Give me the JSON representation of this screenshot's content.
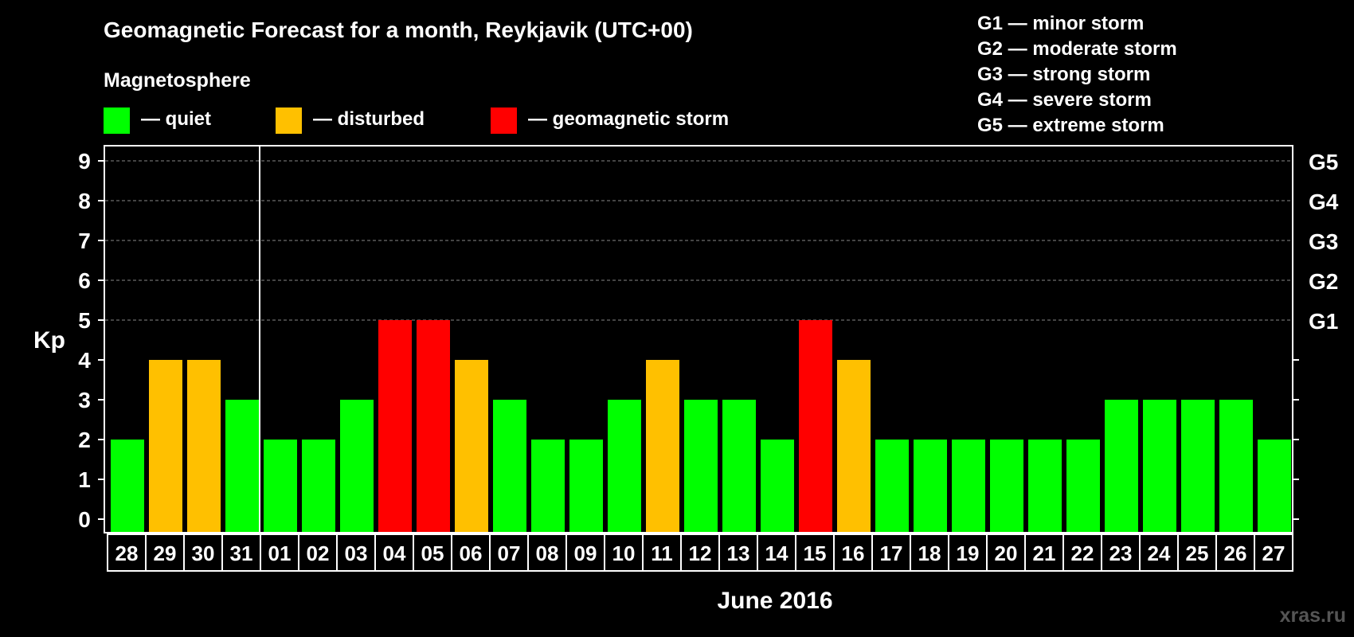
{
  "title": "Geomagnetic Forecast for a month, Reykjavik (UTC+00)",
  "section_label": "Magnetosphere",
  "legend": [
    {
      "label": "— quiet",
      "color": "#00ff00"
    },
    {
      "label": "— disturbed",
      "color": "#ffc000"
    },
    {
      "label": "— geomagnetic storm",
      "color": "#ff0000"
    }
  ],
  "g_scale": [
    "G1 — minor storm",
    "G2 — moderate storm",
    "G3 — strong storm",
    "G4 — severe storm",
    "G5 — extreme storm"
  ],
  "watermark": "xras.ru",
  "colors": {
    "background": "#000000",
    "axis": "#ffffff",
    "grid": "#888888",
    "quiet": "#00ff00",
    "disturbed": "#ffc000",
    "storm": "#ff0000"
  },
  "chart_data": {
    "type": "bar",
    "title": "Geomagnetic Forecast for a month, Reykjavik (UTC+00)",
    "xlabel": "June 2016",
    "ylabel": "Kp",
    "ylim": [
      0,
      9
    ],
    "yticks": [
      "0",
      "1",
      "2",
      "3",
      "4",
      "5",
      "6",
      "7",
      "8",
      "9"
    ],
    "right_axis_labels": [
      {
        "kp": 5,
        "label": "G1"
      },
      {
        "kp": 6,
        "label": "G2"
      },
      {
        "kp": 7,
        "label": "G3"
      },
      {
        "kp": 8,
        "label": "G4"
      },
      {
        "kp": 9,
        "label": "G5"
      }
    ],
    "grid": "horizontal dashed at Kp 5-9",
    "month_divider_after": "31",
    "categories": [
      "28",
      "29",
      "30",
      "31",
      "01",
      "02",
      "03",
      "04",
      "05",
      "06",
      "07",
      "08",
      "09",
      "10",
      "11",
      "12",
      "13",
      "14",
      "15",
      "16",
      "17",
      "18",
      "19",
      "20",
      "21",
      "22",
      "23",
      "24",
      "25",
      "26",
      "27"
    ],
    "values": [
      2,
      4,
      4,
      3,
      2,
      2,
      3,
      5,
      5,
      4,
      3,
      2,
      2,
      3,
      4,
      3,
      3,
      2,
      5,
      4,
      2,
      2,
      2,
      2,
      2,
      2,
      3,
      3,
      3,
      3,
      2
    ],
    "status": [
      "quiet",
      "disturbed",
      "disturbed",
      "quiet",
      "quiet",
      "quiet",
      "quiet",
      "storm",
      "storm",
      "disturbed",
      "quiet",
      "quiet",
      "quiet",
      "quiet",
      "disturbed",
      "quiet",
      "quiet",
      "quiet",
      "storm",
      "disturbed",
      "quiet",
      "quiet",
      "quiet",
      "quiet",
      "quiet",
      "quiet",
      "quiet",
      "quiet",
      "quiet",
      "quiet",
      "quiet"
    ]
  }
}
